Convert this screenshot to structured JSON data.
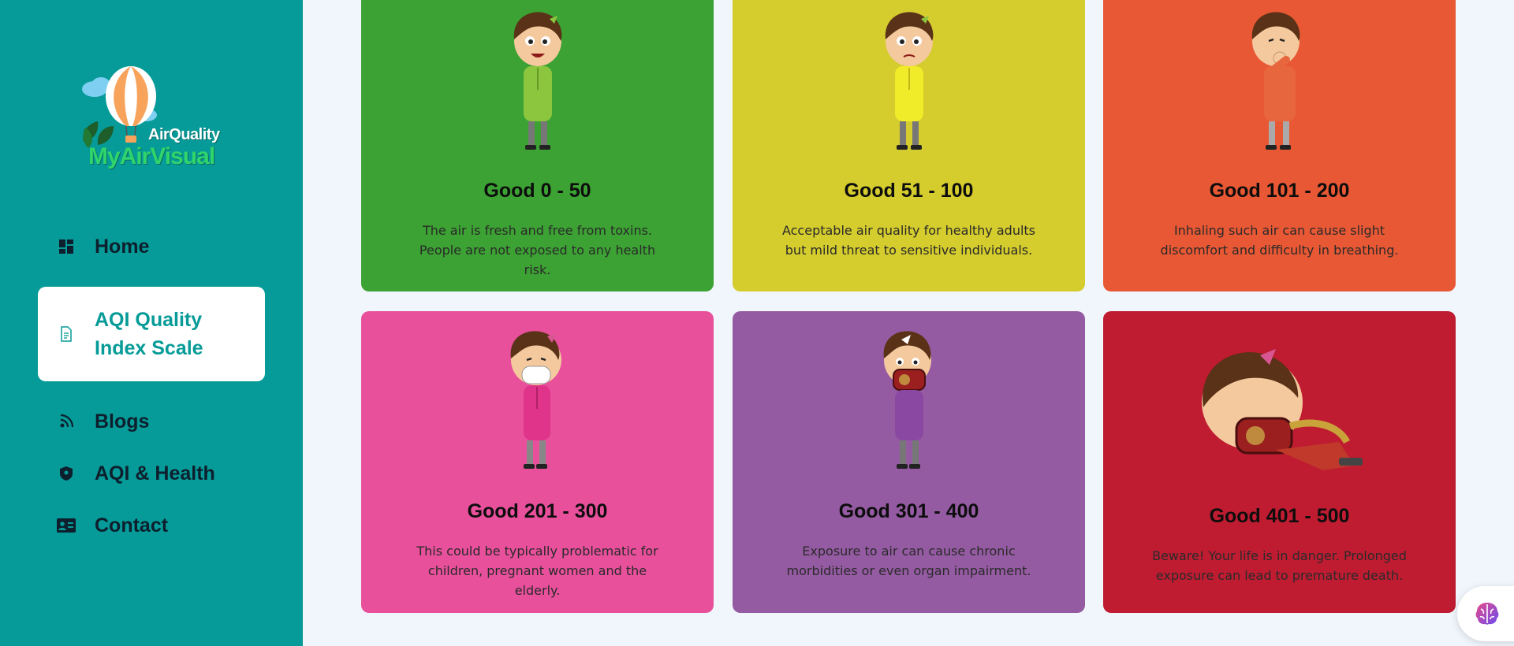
{
  "brand": {
    "top_text": "AirQuality",
    "main_text": "MyAirVisual"
  },
  "nav": {
    "items": [
      {
        "label": "Home",
        "icon": "dashboard-icon"
      },
      {
        "label": "AQI Quality Index Scale",
        "icon": "document-icon",
        "active": true
      },
      {
        "label": "Blogs",
        "icon": "rss-icon"
      },
      {
        "label": "AQI & Health",
        "icon": "shield-icon"
      },
      {
        "label": "Contact",
        "icon": "contact-card-icon"
      }
    ]
  },
  "cards": [
    {
      "title": "Good 0 - 50",
      "desc": "The air is fresh and free from toxins. People are not exposed to any health risk.",
      "color": "#3ca233",
      "shirt": "#8cc63f"
    },
    {
      "title": "Good 51 - 100",
      "desc": "Acceptable air quality for healthy adults but mild threat to sensitive individuals.",
      "color": "#d5cc2d",
      "shirt": "#f1ec2a"
    },
    {
      "title": "Good 101 - 200",
      "desc": "Inhaling such air can cause slight discomfort and difficulty in breathing.",
      "color": "#e95834",
      "shirt": "#e8663d"
    },
    {
      "title": "Good 201 - 300",
      "desc": "This could be typically problematic for children, pregnant women and the elderly.",
      "color": "#e8509c",
      "shirt": "#e0338a"
    },
    {
      "title": "Good 301 - 400",
      "desc": "Exposure to air can cause chronic morbidities or even organ impairment.",
      "color": "#955ba2",
      "shirt": "#8a48a3"
    },
    {
      "title": "Good 401 - 500",
      "desc": "Beware! Your life is in danger. Prolonged exposure can lead to premature death.",
      "color": "#bf1c31",
      "shirt": "#c0392b"
    }
  ],
  "chat": {
    "icon": "brain-chat-icon"
  }
}
